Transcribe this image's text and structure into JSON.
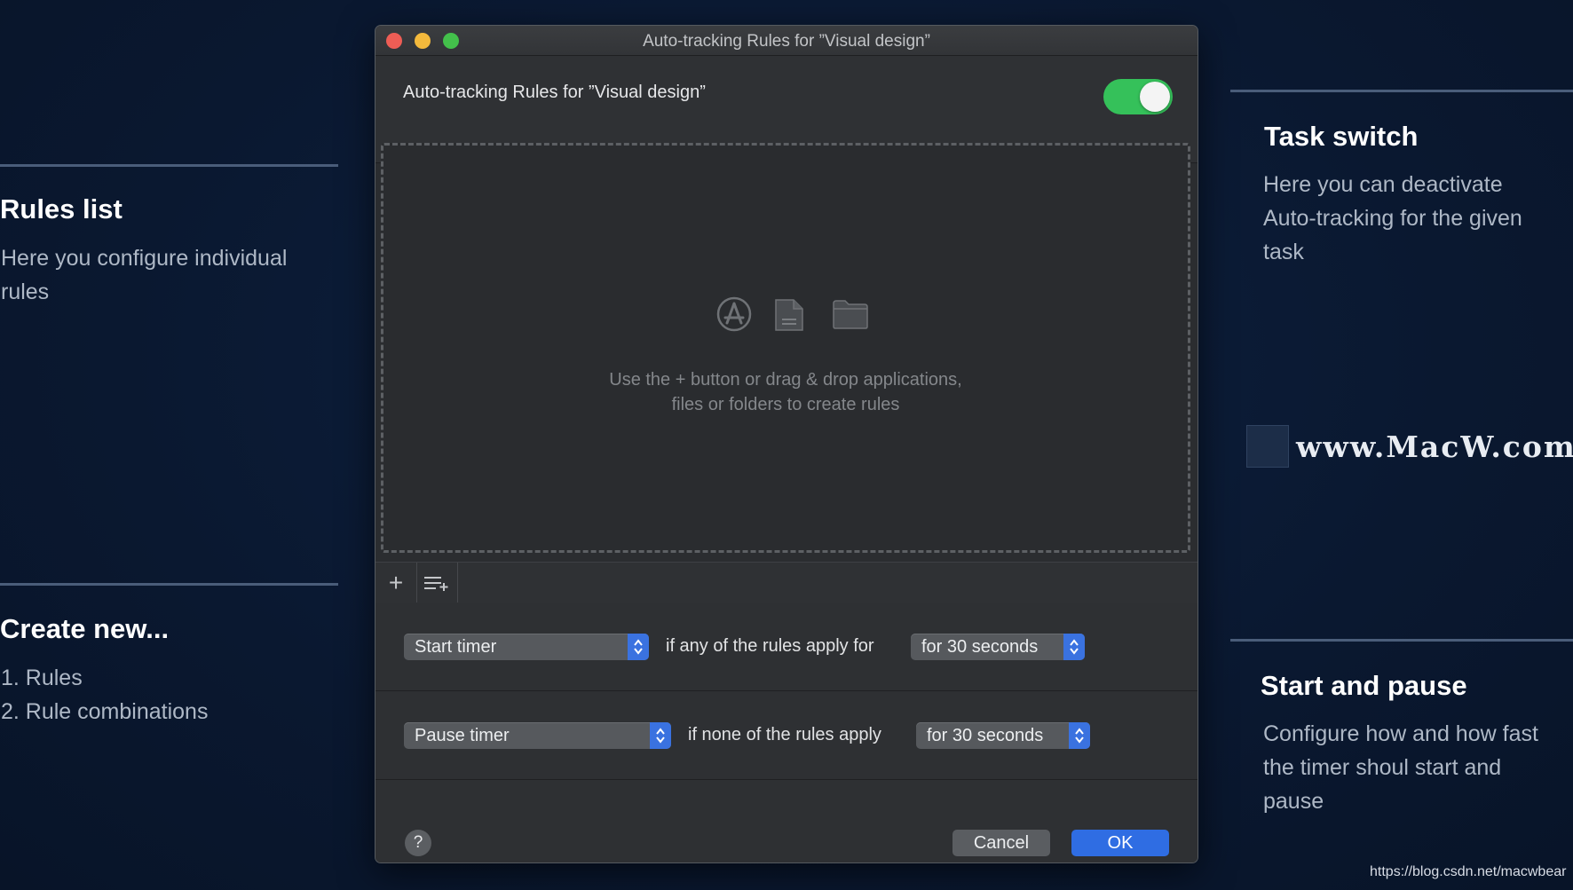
{
  "annotations": {
    "rules_list": {
      "title": "Rules list",
      "text_line1": "Here you configure individual",
      "text_line2": "rules"
    },
    "create_new": {
      "title": "Create new...",
      "item1": "1. Rules",
      "item2": "2. Rule combinations"
    },
    "task_switch": {
      "title": "Task switch",
      "text_line1": "Here you can deactivate",
      "text_line2": "Auto-tracking for the given",
      "text_line3": "task"
    },
    "start_pause": {
      "title": "Start and pause",
      "text_line1": "Configure how and how fast",
      "text_line2": "the timer shoul start and",
      "text_line3": "pause"
    }
  },
  "dialog": {
    "window_title": "Auto-tracking Rules for ”Visual design”",
    "header_title": "Auto-tracking Rules for ”Visual design”",
    "toggle_on": true,
    "toggle_color": "#35c15a",
    "dropzone": {
      "icons": [
        "app-store-icon",
        "document-icon",
        "folder-icon"
      ],
      "hint_line1": "Use the + button or drag & drop applications,",
      "hint_line2": "files or folders to create rules"
    },
    "toolbar": {
      "add_label": "+",
      "add_combination_icon": "add-combination-icon"
    },
    "start_rule": {
      "action": "Start timer",
      "condition": "if any of the rules apply for",
      "duration": "for 30 seconds"
    },
    "pause_rule": {
      "action": "Pause timer",
      "condition": "if none of the rules apply",
      "duration": "for 30 seconds"
    },
    "help_label": "?",
    "cancel_label": "Cancel",
    "ok_label": "OK",
    "accent_color": "#2f6de3"
  },
  "watermark": {
    "text": "www.MacW.com"
  },
  "credit": "https://blog.csdn.net/macwbear"
}
